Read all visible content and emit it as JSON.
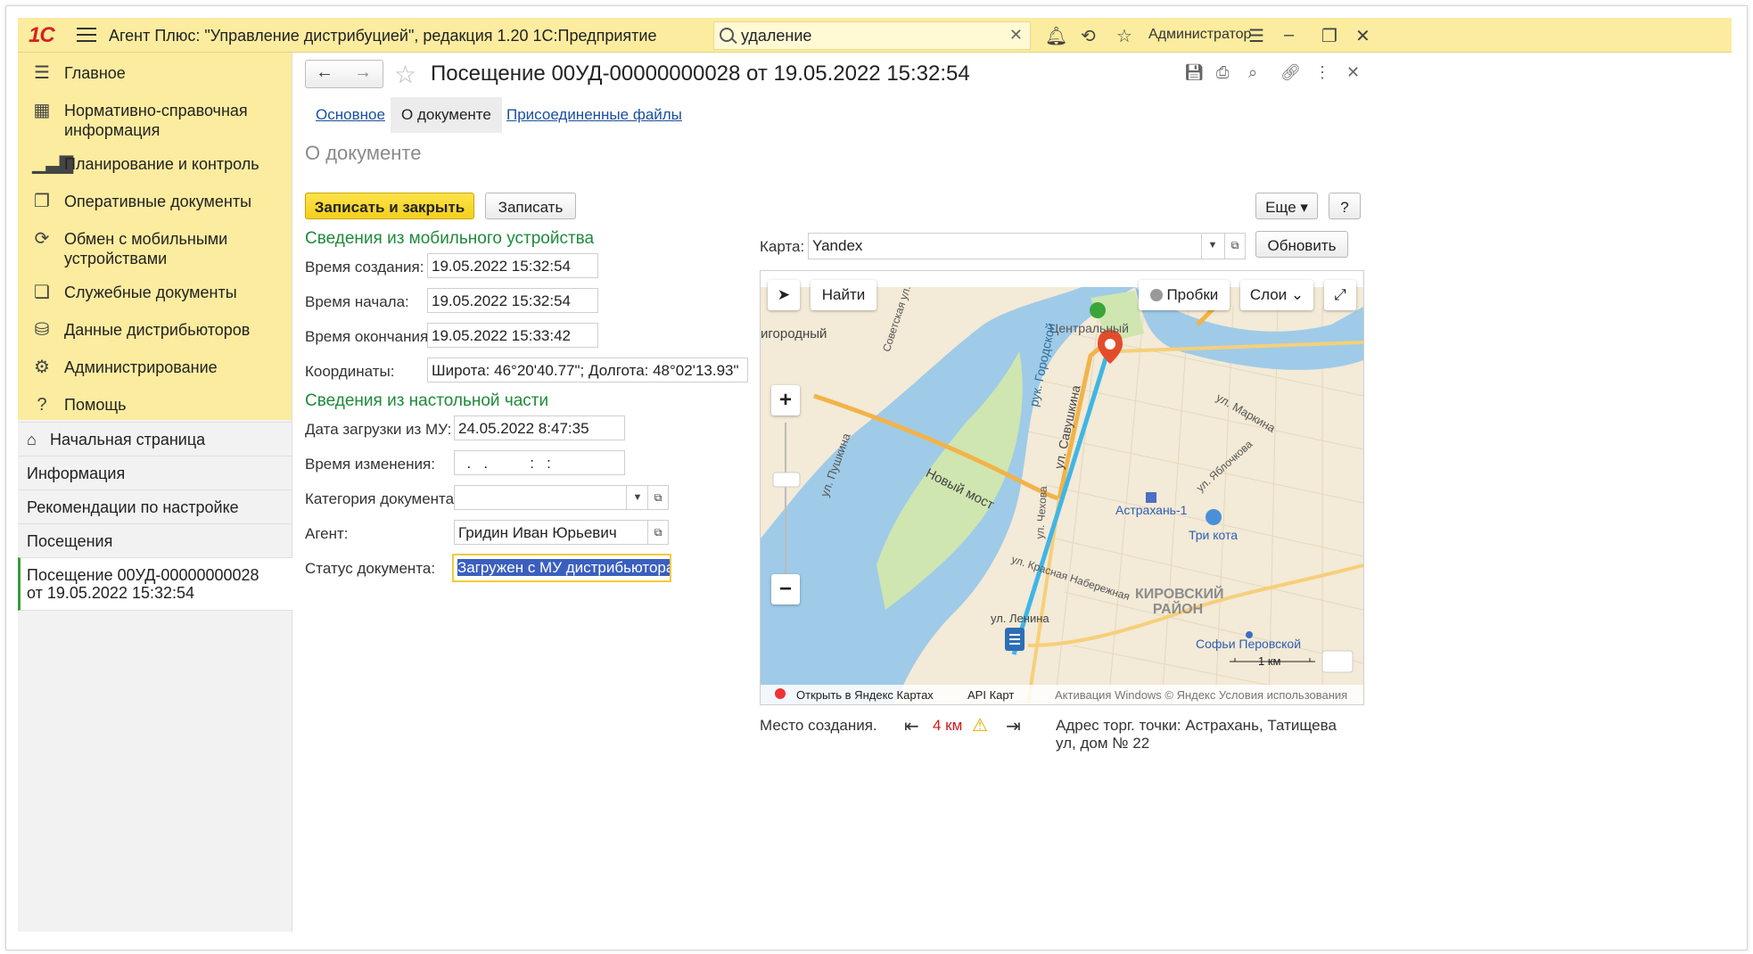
{
  "topbar": {
    "logo": "1С",
    "title": "Агент Плюс: \"Управление дистрибуцией\", редакция 1.20 1С:Предприятие",
    "search_value": "удаление",
    "user": "Администратор"
  },
  "sidebar": {
    "sections": [
      {
        "label": "Главное",
        "icon": "menu-icon"
      },
      {
        "label": "Нормативно-справочная информация",
        "icon": "grid-icon"
      },
      {
        "label": "Планирование и контроль",
        "icon": "bar-chart-icon"
      },
      {
        "label": "Оперативные документы",
        "icon": "documents-icon"
      },
      {
        "label": "Обмен с мобильными устройствами",
        "icon": "sync-icon"
      },
      {
        "label": "Служебные документы",
        "icon": "service-docs-icon"
      },
      {
        "label": "Данные дистрибьюторов",
        "icon": "distributor-icon"
      },
      {
        "label": "Администрирование",
        "icon": "gear-icon"
      },
      {
        "label": "Помощь",
        "icon": "help-icon"
      }
    ],
    "nav": [
      {
        "label": "Начальная страница",
        "icon": "home-icon"
      },
      {
        "label": "Информация"
      },
      {
        "label": "Рекомендации по настройке"
      },
      {
        "label": "Посещения"
      },
      {
        "label": "Посещение 00УД-00000000028 от 19.05.2022 15:32:54"
      }
    ]
  },
  "document": {
    "title": "Посещение 00УД-00000000028 от 19.05.2022 15:32:54",
    "tabs": [
      "Основное",
      "О документе",
      "Присоединенные файлы"
    ],
    "active_tab": "О документе",
    "section_title": "О документе",
    "buttons": {
      "save_close": "Записать и закрыть",
      "save": "Записать",
      "more": "Еще",
      "help": "?",
      "refresh": "Обновить"
    }
  },
  "mobile_info": {
    "title": "Сведения из мобильного устройства",
    "created_label": "Время создания:",
    "created_value": "19.05.2022 15:32:54",
    "start_label": "Время начала:",
    "start_value": "19.05.2022 15:32:54",
    "end_label": "Время окончания:",
    "end_value": "19.05.2022 15:33:42",
    "coords_label": "Координаты:",
    "coords_value": "Широта: 46°20'40.77\"; Долгота: 48°02'13.93\""
  },
  "desktop_info": {
    "title": "Сведения из настольной части",
    "upload_label": "Дата загрузки из МУ:",
    "upload_value": "24.05.2022  8:47:35",
    "changed_label": "Время изменения:",
    "changed_value": "  .   .          :   :",
    "category_label": "Категория документа:",
    "category_value": "",
    "agent_label": "Агент:",
    "agent_value": "Гридин Иван Юрьевич",
    "status_label": "Статус документа:",
    "status_value": "Загружен с МУ дистрибьютора"
  },
  "map": {
    "label": "Карта:",
    "provider": "Yandex",
    "find": "Найти",
    "traffic": "Пробки",
    "layers": "Слои",
    "labels": {
      "district_left": "игородный",
      "center": "Центральный",
      "bridge": "Новый мост",
      "savushkina": "ул. Савушкина",
      "gorodskoy": "рук. Городской",
      "pushkina": "ул. Пушкина",
      "markina": "ул. Маркина",
      "yablochkova": "ул. Яблочкова",
      "astrakhan": "Астрахань-1",
      "tri_kota": "Три кота",
      "chekhova": "ул. Чехова",
      "krasnaya": "ул. Красная Набережная",
      "kirovsky": "КИРОВСКИЙ РАЙОН",
      "lenina": "ул. Ленина",
      "sofya": "Софьи Перовской",
      "scale": "1 км",
      "sovetskaya": "Советская ул."
    },
    "footer_open": "Открыть в Яндекс Картах",
    "footer_api": "API Карт",
    "footer_copy": "Активация Windows  © Яндекс  Условия использования"
  },
  "bottom": {
    "place_label": "Место создания.",
    "distance": "4 км",
    "address": "Адрес торг. точки: Астрахань, Татищева ул, дом № 22"
  },
  "colors": {
    "accent_yellow": "#fbec9f",
    "group_green": "#1f8a3a",
    "link_blue": "#1a4fa0",
    "warn_red": "#d11a1a"
  }
}
